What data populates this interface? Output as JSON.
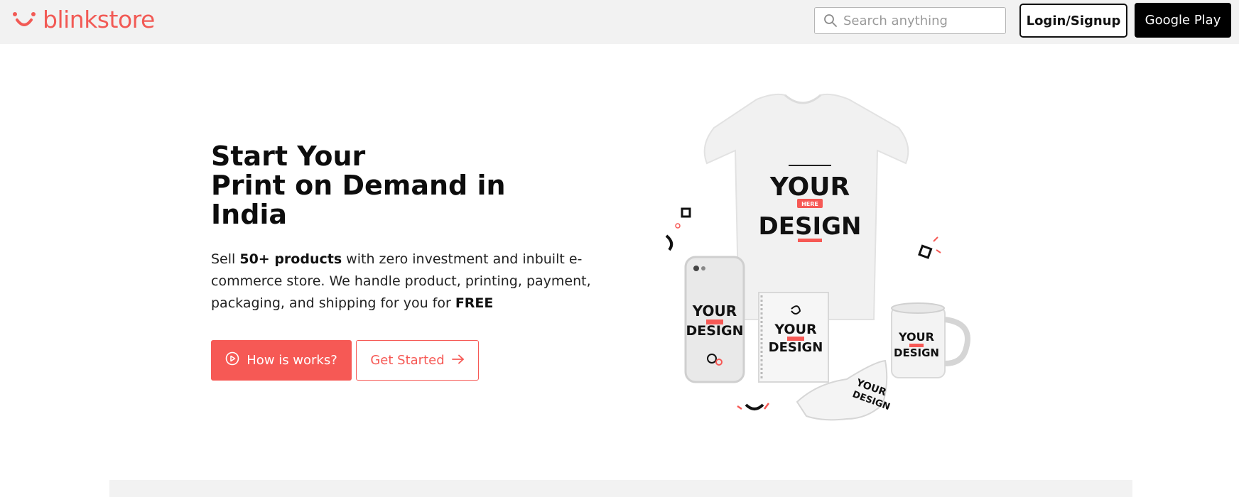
{
  "brand": {
    "name": "blinkstore",
    "color": "#f25a55"
  },
  "header": {
    "search_placeholder": "Search anything",
    "login_label": "Login/Signup",
    "gplay_label": "Google Play"
  },
  "hero": {
    "title_lines": [
      "Start Your",
      "Print on Demand in",
      "India"
    ],
    "desc": {
      "p1": "Sell ",
      "b1": "50+ products",
      "p2": " with zero investment and inbuilt e-commerce store. We handle product, printing, payment, packaging, and shipping for you for ",
      "b2": "FREE"
    },
    "how_label": "How is works?",
    "start_label": "Get Started"
  },
  "product_image": {
    "design_line1": "YOUR",
    "design_line2": "DESIGN",
    "design_tag": "HERE"
  },
  "colors": {
    "accent": "#f65955",
    "header_bg": "#f2f2f2"
  }
}
